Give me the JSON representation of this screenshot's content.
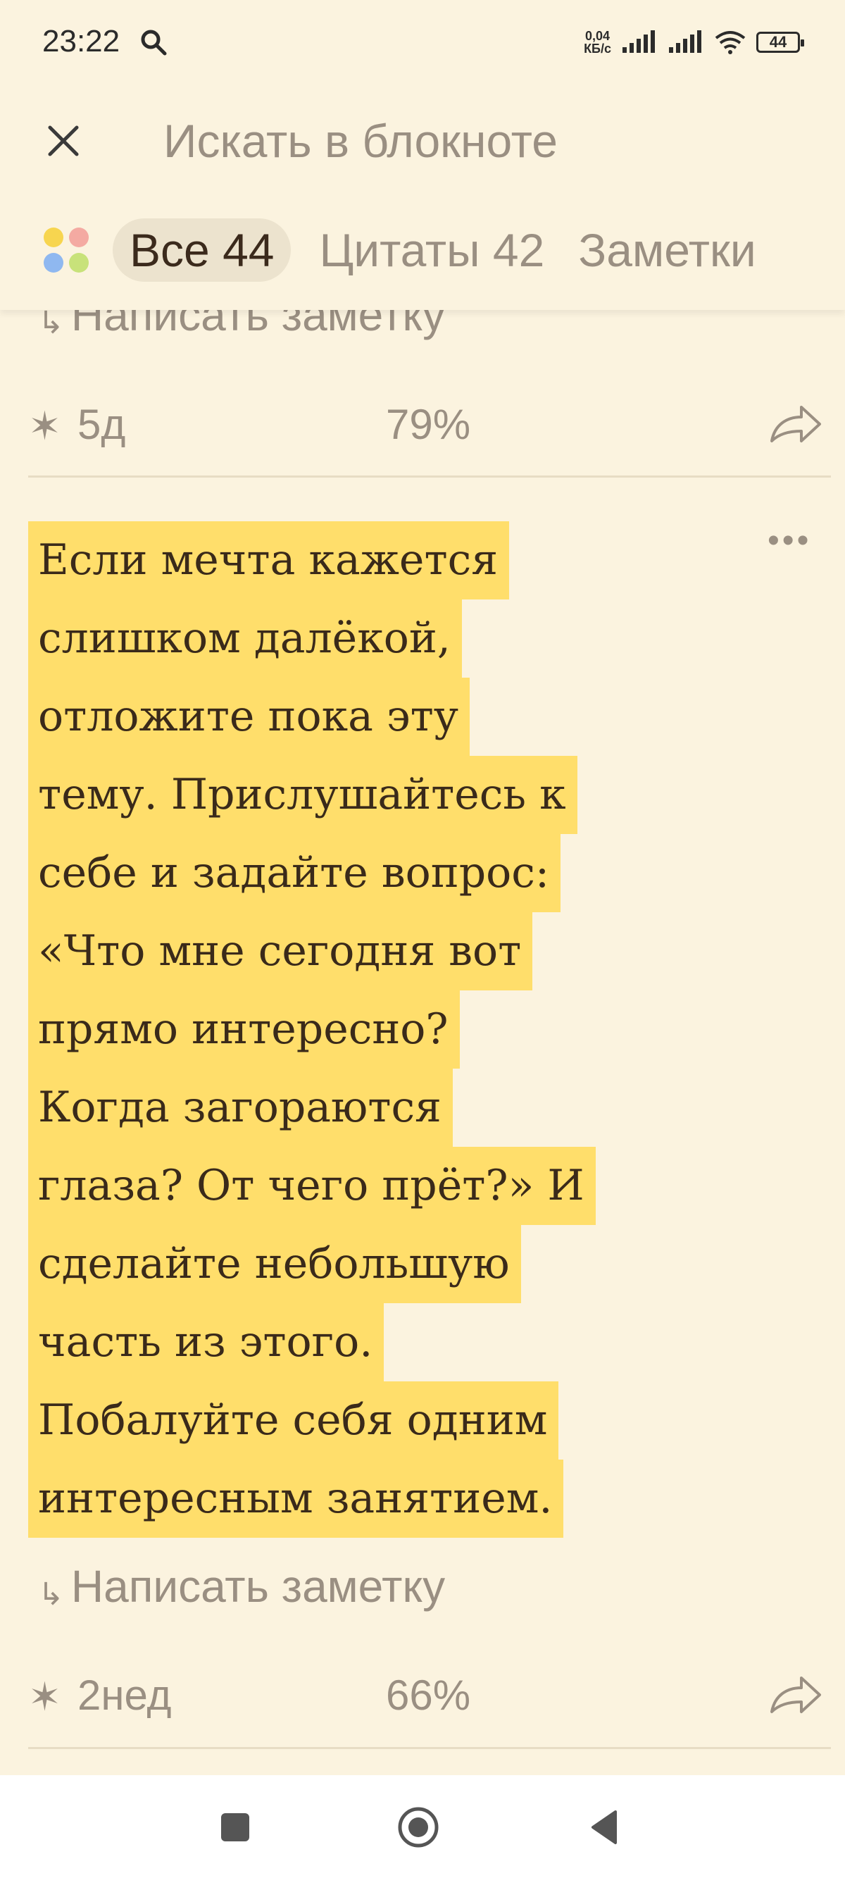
{
  "status_bar": {
    "time": "23:22",
    "net_speed_value": "0,04",
    "net_speed_unit": "КБ/с",
    "battery": "44"
  },
  "header": {
    "search_placeholder": "Искать в блокноте",
    "filters": [
      {
        "label": "Все 44",
        "active": true
      },
      {
        "label": "Цитаты 42",
        "active": false
      },
      {
        "label": "Заметки",
        "active": false
      }
    ]
  },
  "cards": [
    {
      "write_note_label": "Написать заметку",
      "age": "5д",
      "progress": "79%"
    },
    {
      "quote_lines": [
        "Если мечта кажется",
        "слишком далёкой,",
        "отложите пока эту",
        "тему. Прислушайтесь к",
        "себе и задайте вопрос:",
        "«Что мне сегодня вот",
        "прямо интересно?",
        "Когда загораются",
        "глаза? От чего прёт?» И",
        "сделайте небольшую",
        "часть из этого.",
        "Побалуйте себя одним",
        "интересным занятием."
      ],
      "write_note_label": "Написать заметку",
      "age": "2нед",
      "progress": "66%",
      "more_label": "•••"
    }
  ],
  "colors": {
    "background": "#fbf3df",
    "highlight": "#ffde6b",
    "muted_text": "#9a8f82",
    "quote_text": "#3a2a1a"
  }
}
